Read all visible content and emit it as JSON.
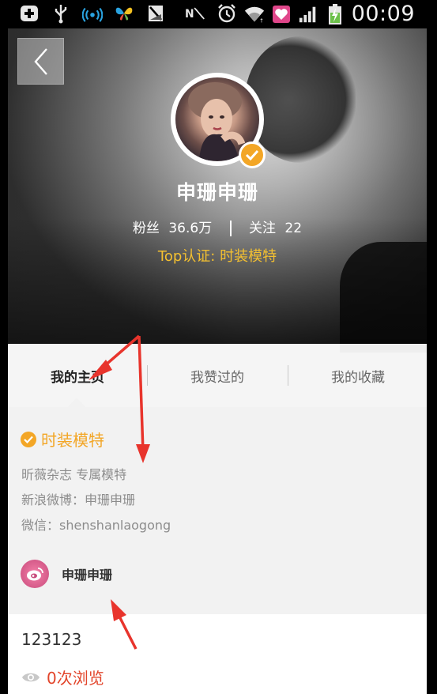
{
  "status_bar": {
    "time": "00:09",
    "icons": [
      "add-box-icon",
      "usb-icon",
      "wifi-hotspot-icon",
      "butterfly-icon",
      "no-sim-icon",
      "nfc-icon",
      "alarm-icon",
      "wifi-icon",
      "heart-app-icon",
      "signal-icon",
      "battery-charging-icon"
    ]
  },
  "header": {
    "back_label": "back",
    "username": "申珊申珊",
    "followers_label": "粉丝",
    "followers_value": "36.6万",
    "following_label": "关注",
    "following_value": "22",
    "certification": "Top认证: 时装模特"
  },
  "tabs": [
    {
      "label": "我的主页"
    },
    {
      "label": "我赞过的"
    },
    {
      "label": "我的收藏"
    }
  ],
  "profile": {
    "badge_title": "时装模特",
    "lines": [
      "昕薇杂志  专属模特",
      "新浪微博：申珊申珊",
      "微信：shenshanlaogong"
    ],
    "weibo_name": "申珊申珊"
  },
  "post": {
    "text": "123123",
    "views": "0次浏览"
  },
  "colors": {
    "accent_gold": "#f3a626",
    "cert_yellow": "#f4c030",
    "views_red": "#e2452b",
    "annotation_red": "#e8342c"
  }
}
